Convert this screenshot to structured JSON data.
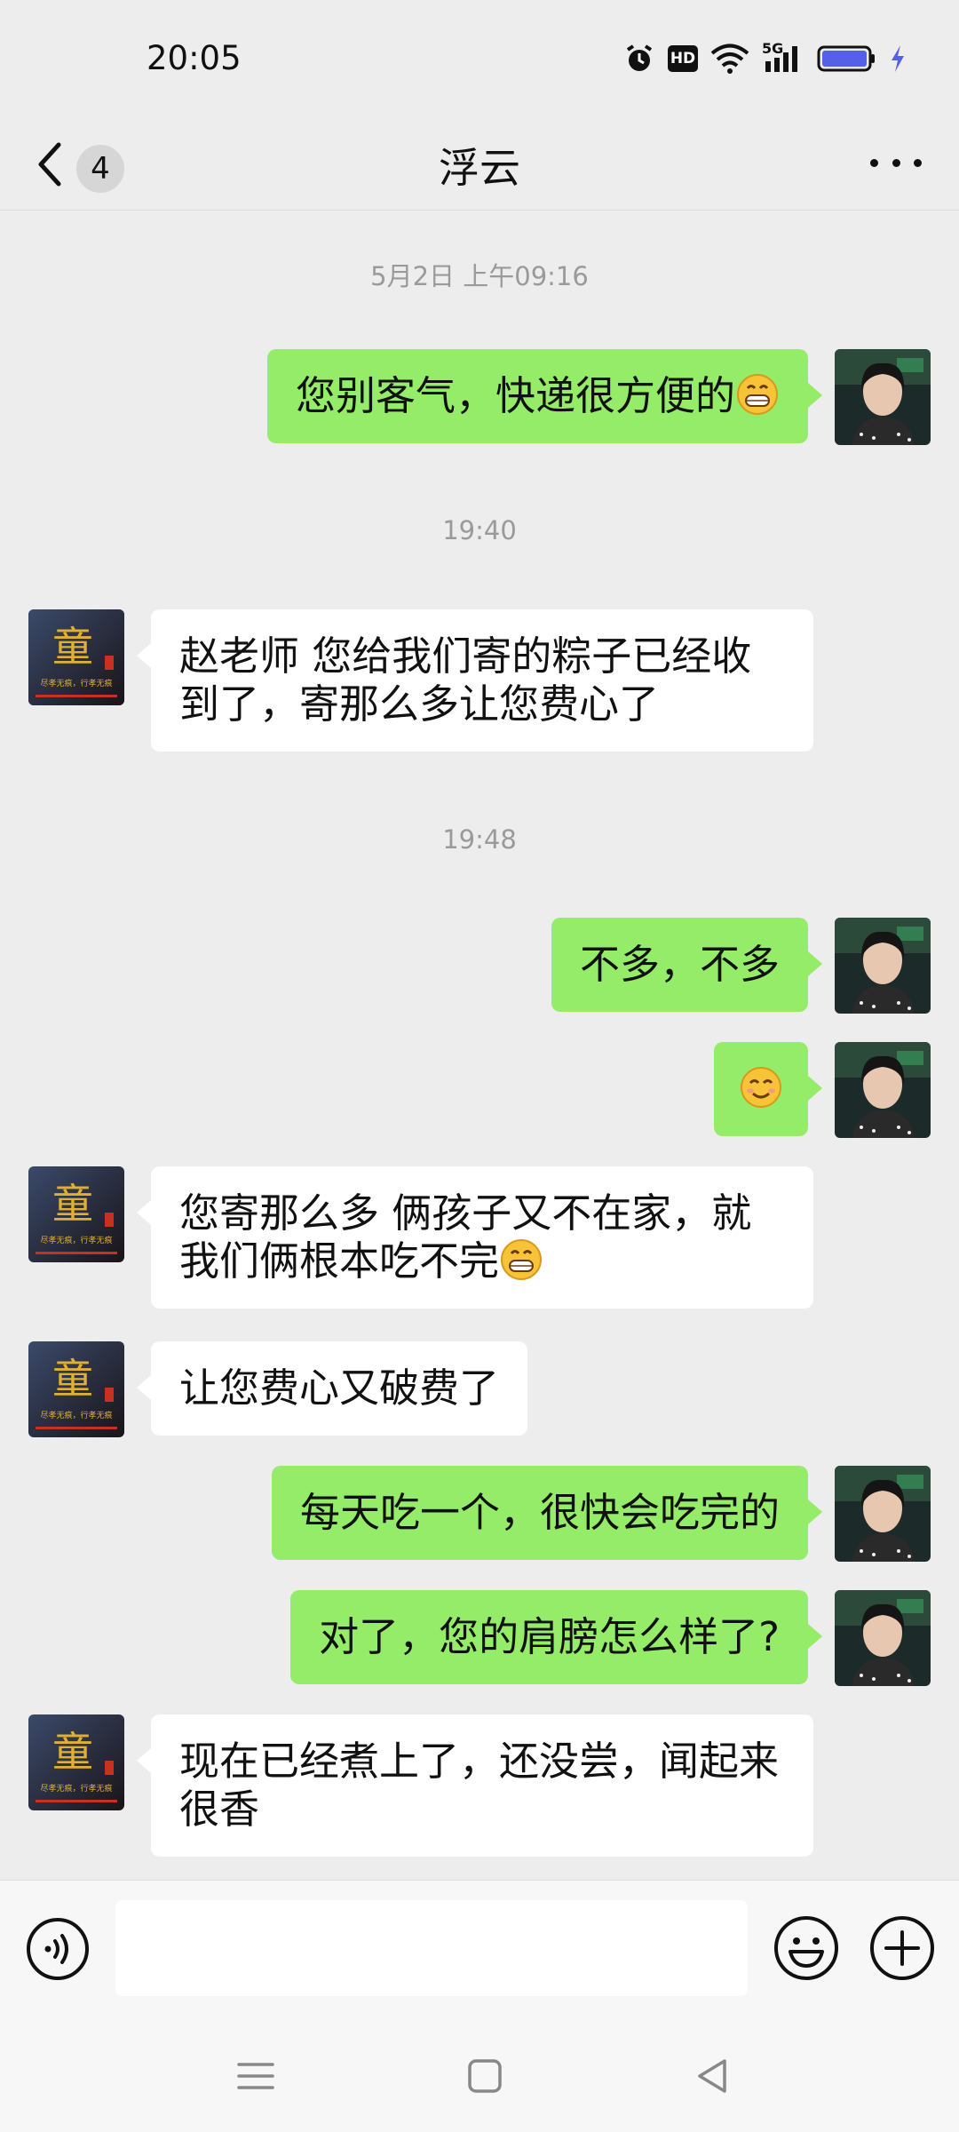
{
  "status_bar": {
    "time": "20:05",
    "icons": [
      "alarm-icon",
      "hd-icon",
      "wifi-icon",
      "5g-signal-icon",
      "battery-icon",
      "charging-icon"
    ],
    "network_label": "5G",
    "hd_label": "HD",
    "battery_color": "#5560e8"
  },
  "nav": {
    "unread_count": "4",
    "title": "浮云"
  },
  "messages": [
    {
      "type": "timestamp",
      "text": "5月2日 上午09:16"
    },
    {
      "type": "me",
      "text": "您别客气，快递很方便的",
      "emoji": "grin"
    },
    {
      "type": "timestamp",
      "text": "19:40"
    },
    {
      "type": "them",
      "line1": "赵老师  您给我们寄的粽子已经收",
      "line2": "到了，寄那么多让您费心了"
    },
    {
      "type": "timestamp",
      "text": "19:48"
    },
    {
      "type": "me",
      "text": "不多，不多"
    },
    {
      "type": "me",
      "emoji": "smile"
    },
    {
      "type": "them",
      "line1": "您寄那么多  俩孩子又不在家，就",
      "line2": "我们俩根本吃不完",
      "emoji": "grin"
    },
    {
      "type": "them",
      "text": "让您费心又破费了"
    },
    {
      "type": "me",
      "text": "每天吃一个，很快会吃完的"
    },
    {
      "type": "me",
      "text": "对了，您的肩膀怎么样了?"
    },
    {
      "type": "them",
      "line1": "现在已经煮上了，还没尝，闻起来",
      "line2": "很香"
    }
  ],
  "avatars": {
    "them_glyph": "童",
    "them_caption": "尽孝无痕，行孝无痕"
  },
  "input": {
    "placeholder": ""
  },
  "colors": {
    "my_bubble": "#95ec69",
    "their_bubble": "#ffffff",
    "background": "#ededed"
  }
}
